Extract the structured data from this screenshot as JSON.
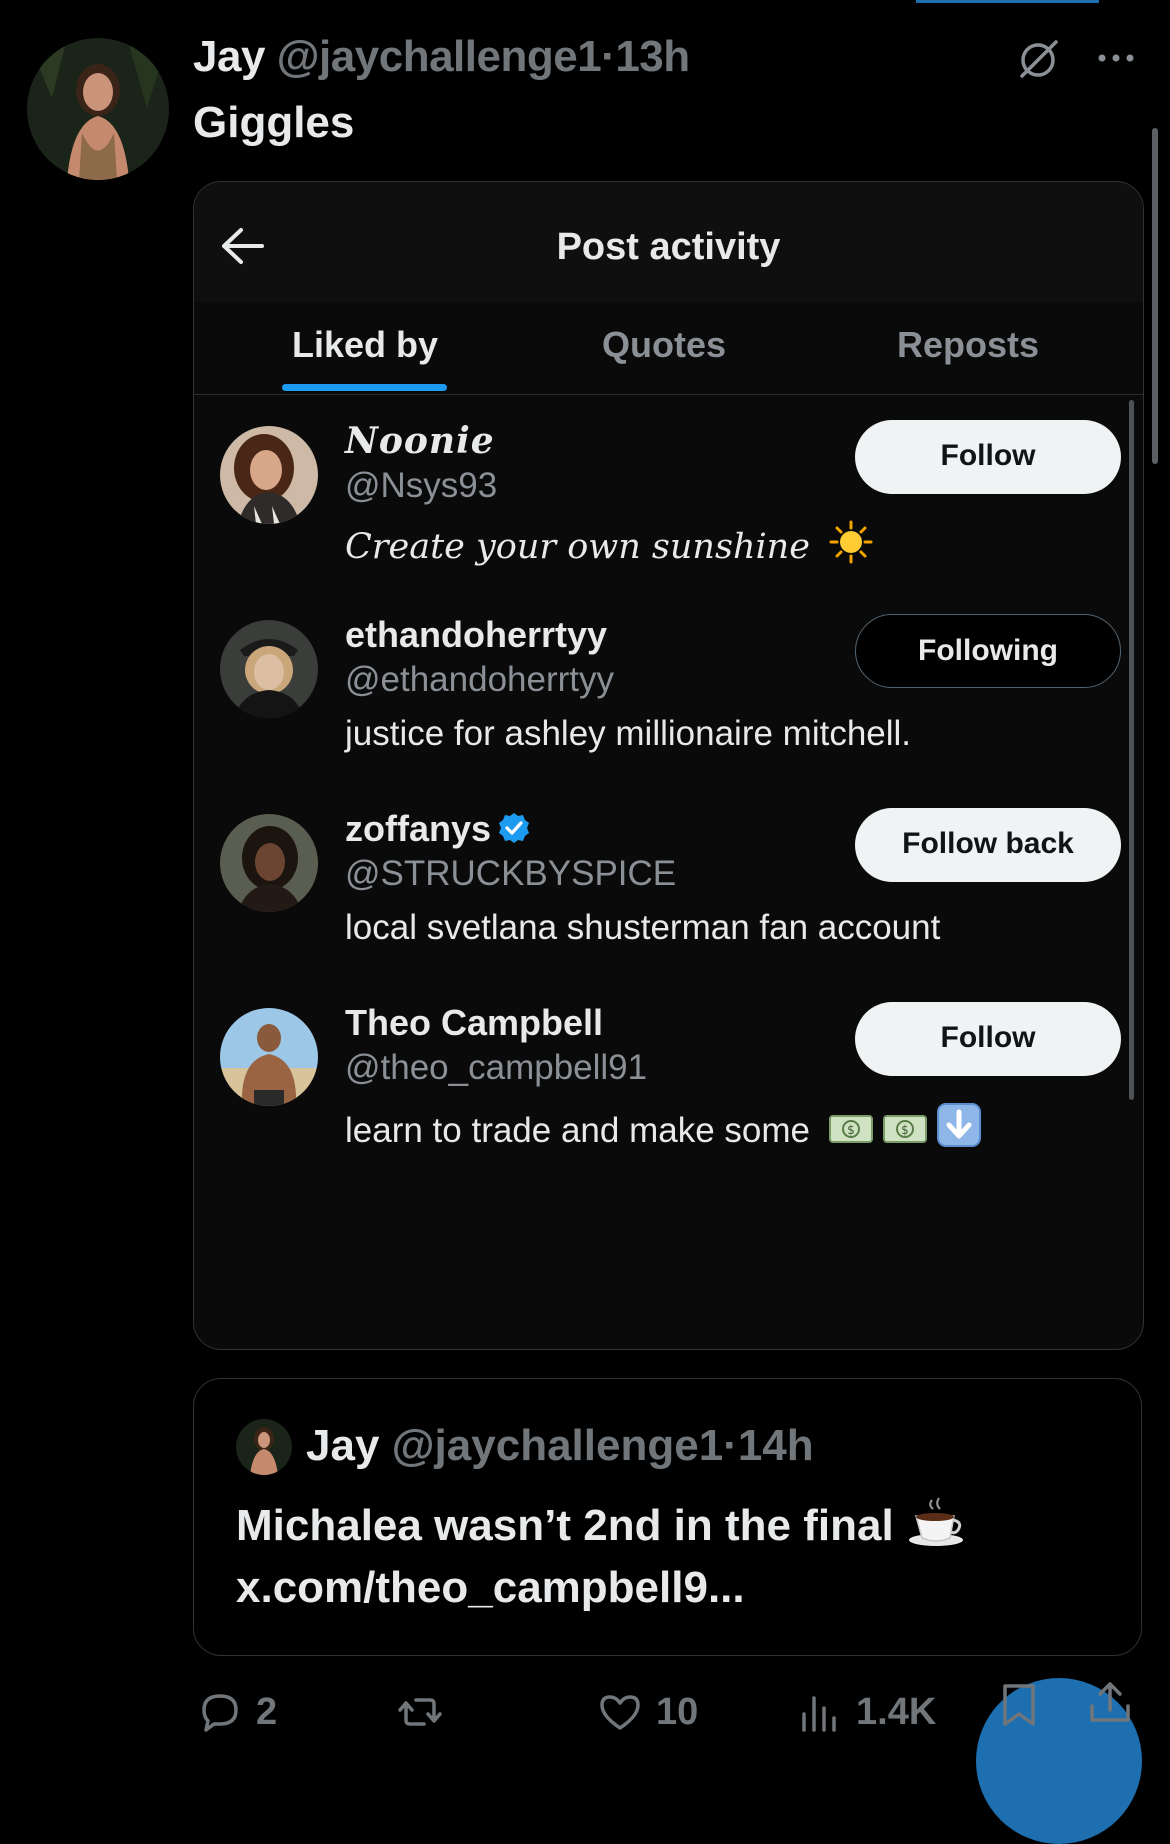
{
  "tweet": {
    "author_name": "Jay",
    "author_handle": "@jaychallenge1",
    "separator": "·",
    "time": "13h",
    "text": "Giggles",
    "icons": [
      "grok-icon",
      "more-icon"
    ]
  },
  "card": {
    "title": "Post activity",
    "tabs": [
      {
        "label": "Liked by",
        "active": true
      },
      {
        "label": "Quotes",
        "active": false
      },
      {
        "label": "Reposts",
        "active": false
      }
    ],
    "users": [
      {
        "name": "Noonie",
        "handle": "@Nsys93",
        "bio": "Create your own sunshine",
        "bio_emoji": "sun",
        "button": "Follow"
      },
      {
        "name": "ethandoherrtyy",
        "handle": "@ethandoherrtyy",
        "bio": "justice for ashley millionaire mitchell.",
        "button": "Following"
      },
      {
        "name": "zoffanys",
        "verified": true,
        "handle": "@STRUCKBYSPICE",
        "bio": "local svetlana shusterman fan account",
        "button": "Follow back"
      },
      {
        "name": "Theo Campbell",
        "handle": "@theo_campbell91",
        "bio": "learn to trade and make some",
        "bio_emoji": "money money down-arrow",
        "button": "Follow"
      }
    ]
  },
  "quote": {
    "author_name": "Jay",
    "author_handle": "@jaychallenge1",
    "separator": "·",
    "time": "14h",
    "text_line1": "Michalea wasn’t 2nd in the final",
    "text_emoji": "coffee",
    "text_line2": "x.com/theo_campbell9..."
  },
  "actions": {
    "replies": "2",
    "reposts": "",
    "likes": "10",
    "views": "1.4K"
  },
  "colors": {
    "background": "#000000",
    "accent": "#1d9bf0",
    "muted": "#71767b"
  }
}
